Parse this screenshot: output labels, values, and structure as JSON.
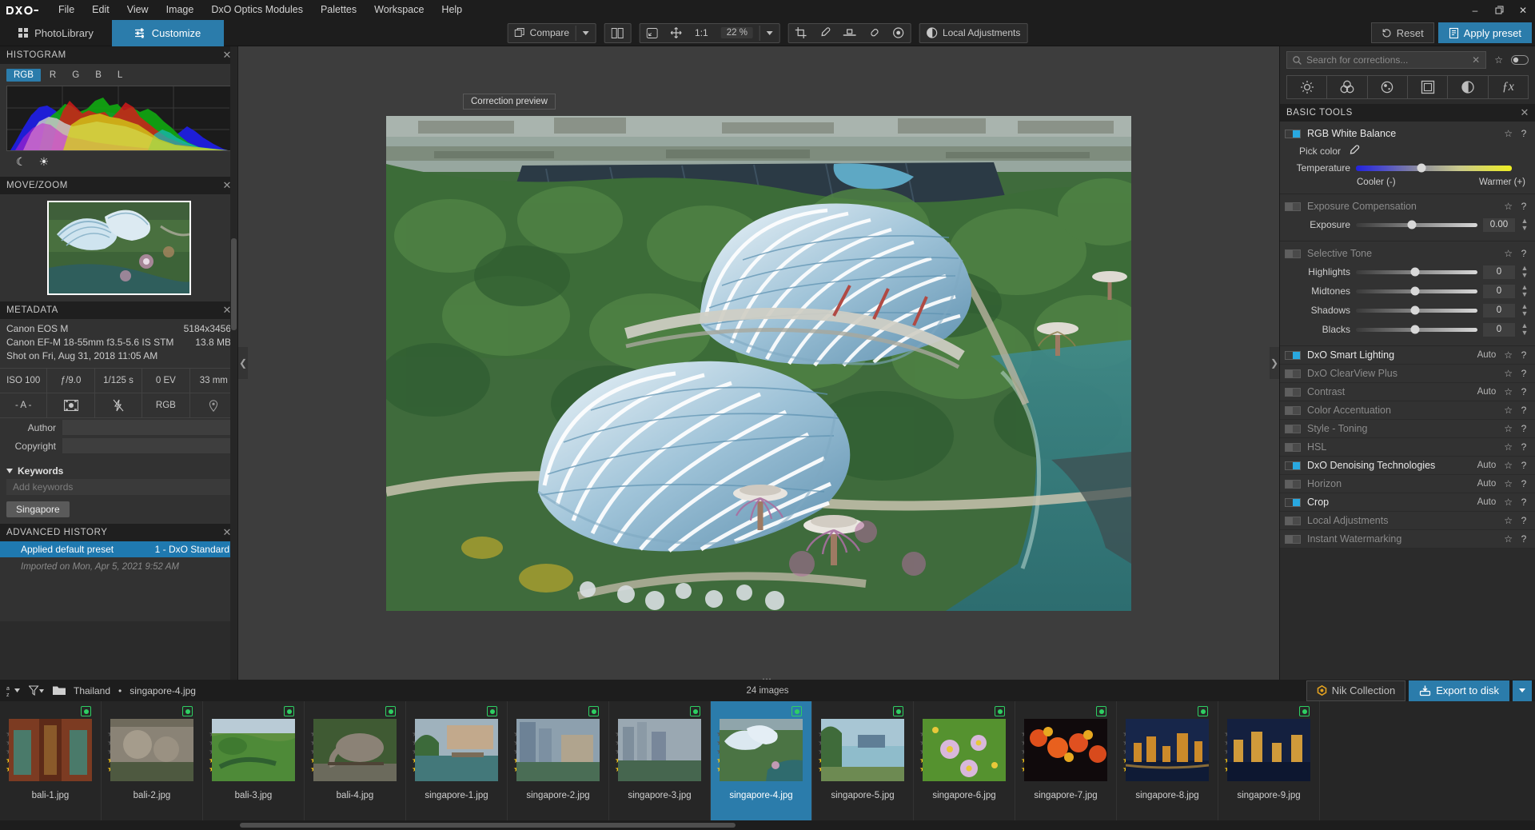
{
  "app": {
    "brand": "DXO",
    "menus": [
      "File",
      "Edit",
      "View",
      "Image",
      "DxO Optics Modules",
      "Palettes",
      "Workspace",
      "Help"
    ],
    "window_buttons": {
      "minimize": "–",
      "maximize": "❐",
      "close": "✕"
    }
  },
  "modes": {
    "photolibrary": "PhotoLibrary",
    "customize": "Customize"
  },
  "toolbar": {
    "compare": "Compare",
    "zoom_fit": "1:1",
    "zoom_level": "22 %",
    "local_adjustments": "Local Adjustments",
    "reset": "Reset",
    "apply_preset": "Apply preset",
    "icons": {
      "compare": "compare-icon",
      "split_view": "split-view-icon",
      "fit": "fit-to-screen-icon",
      "pan": "pan-move-icon",
      "crop": "crop-icon",
      "eyedropper": "eyedropper-icon",
      "horizon": "horizon-icon",
      "repair": "repair-brush-icon",
      "preview_eye": "preview-eye-icon",
      "local_adj": "local-adjustments-icon",
      "reset": "reset-history-icon",
      "apply_preset": "apply-preset-icon"
    }
  },
  "tooltip": {
    "text": "Correction preview"
  },
  "histogram": {
    "title": "HISTOGRAM",
    "channels": [
      "RGB",
      "R",
      "G",
      "B",
      "L"
    ],
    "active_channel": "RGB",
    "icons": [
      "moon-shadow-clipping-icon",
      "sun-highlight-clipping-icon"
    ]
  },
  "movezoom": {
    "title": "MOVE/ZOOM"
  },
  "metadata": {
    "title": "METADATA",
    "camera": "Canon EOS M",
    "dimensions": "5184x3456",
    "lens": "Canon EF-M 18-55mm f3.5-5.6 IS STM",
    "filesize": "13.8 MB",
    "shot_on": "Shot on Fri, Aug 31, 2018 11:05 AM",
    "exif_row1": [
      "ISO 100",
      "ƒ/9.0",
      "1/125 s",
      "0 EV",
      "33 mm"
    ],
    "exif_row2": [
      "- A -",
      "metering-icon",
      "flash-off-icon",
      "RGB",
      "geolocation-icon"
    ],
    "author_label": "Author",
    "author_value": "",
    "copyright_label": "Copyright",
    "copyright_value": "",
    "keywords_label": "Keywords",
    "keywords_placeholder": "Add keywords",
    "keywords": [
      "Singapore"
    ]
  },
  "advanced_history": {
    "title": "ADVANCED HISTORY",
    "entry_label": "Applied default preset",
    "entry_value": "1 - DxO Standard",
    "imported_note": "Imported on Mon, Apr 5, 2021 9:52 AM"
  },
  "right_panel": {
    "search_placeholder": "Search for corrections...",
    "icon_tabs": [
      "light-icon",
      "color-icon",
      "detail-icon",
      "geometry-icon",
      "local-adjust-icon",
      "fx-icon"
    ],
    "section_title": "BASIC TOOLS",
    "tools": [
      {
        "name": "RGB White Balance",
        "enabled": true,
        "auto": "",
        "pick_color_label": "Pick color",
        "sliders": [
          {
            "label": "Temperature",
            "value": "",
            "pos": 42,
            "style": "temp"
          }
        ],
        "ends": {
          "left": "Cooler (-)",
          "right": "Warmer (+)"
        }
      },
      {
        "name": "Exposure Compensation",
        "enabled": false,
        "auto": "",
        "sliders": [
          {
            "label": "Exposure",
            "value": "0.00",
            "pos": 46,
            "style": "grey"
          }
        ]
      },
      {
        "name": "Selective Tone",
        "enabled": false,
        "auto": "",
        "sliders": [
          {
            "label": "Highlights",
            "value": "0",
            "pos": 49,
            "style": "grey"
          },
          {
            "label": "Midtones",
            "value": "0",
            "pos": 49,
            "style": "grey"
          },
          {
            "label": "Shadows",
            "value": "0",
            "pos": 49,
            "style": "grey"
          },
          {
            "label": "Blacks",
            "value": "0",
            "pos": 49,
            "style": "grey"
          }
        ]
      }
    ],
    "tool_rows": [
      {
        "name": "DxO Smart Lighting",
        "enabled": true,
        "auto": "Auto"
      },
      {
        "name": "DxO ClearView Plus",
        "enabled": false,
        "auto": ""
      },
      {
        "name": "Contrast",
        "enabled": false,
        "auto": "Auto"
      },
      {
        "name": "Color Accentuation",
        "enabled": false,
        "auto": ""
      },
      {
        "name": "Style - Toning",
        "enabled": false,
        "auto": ""
      },
      {
        "name": "HSL",
        "enabled": false,
        "auto": ""
      },
      {
        "name": "DxO Denoising Technologies",
        "enabled": true,
        "auto": "Auto"
      },
      {
        "name": "Horizon",
        "enabled": false,
        "auto": "Auto"
      },
      {
        "name": "Crop",
        "enabled": true,
        "auto": "Auto"
      },
      {
        "name": "Local Adjustments",
        "enabled": false,
        "auto": ""
      },
      {
        "name": "Instant Watermarking",
        "enabled": false,
        "auto": ""
      }
    ]
  },
  "filmstrip": {
    "sort_icon": "sort-az-icon",
    "filter_icon": "filter-funnel-icon",
    "folder_icon": "folder-icon",
    "breadcrumb_folder": "Thailand",
    "breadcrumb_sep": "•",
    "breadcrumb_file": "singapore-4.jpg",
    "image_count": "24 images",
    "nik_collection": "Nik Collection",
    "export_to_disk": "Export to disk",
    "selected": "singapore-4.jpg",
    "items": [
      {
        "name": "bali-1.jpg",
        "stars": 2,
        "c1": "#7c3b22",
        "c2": "#4a7a46"
      },
      {
        "name": "bali-2.jpg",
        "stars": 2,
        "c1": "#8a8376",
        "c2": "#4e5940"
      },
      {
        "name": "bali-3.jpg",
        "stars": 2,
        "c1": "#5f9040",
        "c2": "#2f6030"
      },
      {
        "name": "bali-4.jpg",
        "stars": 2,
        "c1": "#7d7668",
        "c2": "#3f5a33"
      },
      {
        "name": "singapore-1.jpg",
        "stars": 2,
        "c1": "#7e8f74",
        "c2": "#3b6f63"
      },
      {
        "name": "singapore-2.jpg",
        "stars": 2,
        "c1": "#7d8a97",
        "c2": "#4a6d55"
      },
      {
        "name": "singapore-3.jpg",
        "stars": 2,
        "c1": "#8f9aa3",
        "c2": "#46664f"
      },
      {
        "name": "singapore-4.jpg",
        "stars": 2,
        "c1": "#86a6bd",
        "c2": "#3d6b46"
      },
      {
        "name": "singapore-5.jpg",
        "stars": 2,
        "c1": "#9fc0cf",
        "c2": "#4d7a4a"
      },
      {
        "name": "singapore-6.jpg",
        "stars": 2,
        "c1": "#6fae3e",
        "c2": "#3d7a2c"
      },
      {
        "name": "singapore-7.jpg",
        "stars": 2,
        "c1": "#d8521d",
        "c2": "#14080a"
      },
      {
        "name": "singapore-8.jpg",
        "stars": 2,
        "c1": "#2a3f6e",
        "c2": "#c67a2a"
      },
      {
        "name": "singapore-9.jpg",
        "stars": 2,
        "c1": "#1d3a63",
        "c2": "#d09a3a"
      }
    ]
  },
  "colors": {
    "accent": "#2b7cab",
    "toggle_on": "#29a8e0",
    "badge_green": "#2ecf63",
    "star_gold": "#f5c518"
  }
}
